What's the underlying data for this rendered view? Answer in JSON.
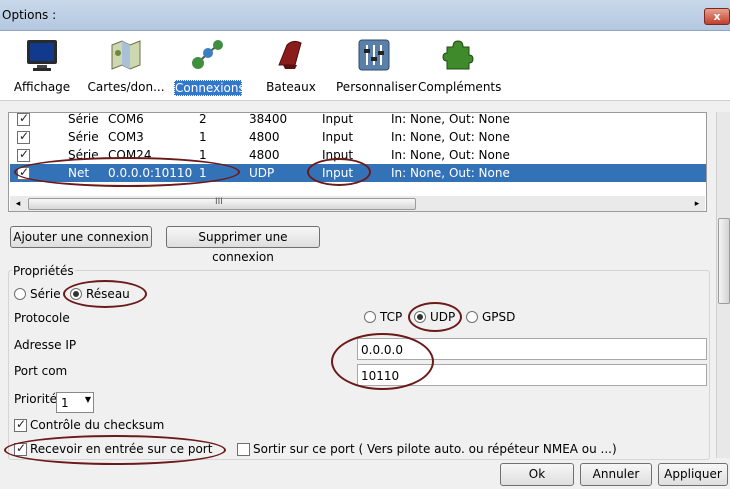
{
  "window": {
    "title": "Options :",
    "close_label": "x"
  },
  "toolbar": [
    {
      "label": "Affichage",
      "icon": "monitor-icon"
    },
    {
      "label": "Cartes/don...",
      "icon": "charts-icon"
    },
    {
      "label": "Connexions",
      "icon": "connections-icon",
      "active": true
    },
    {
      "label": "Bateaux",
      "icon": "boat-icon"
    },
    {
      "label": "Personnaliser",
      "icon": "sliders-icon"
    },
    {
      "label": "Compléments",
      "icon": "puzzle-icon"
    }
  ],
  "connections": {
    "rows": [
      {
        "enabled": true,
        "type": "Série",
        "port": "COM6",
        "priority": "2",
        "speed": "38400",
        "direction": "Input",
        "filter": "In: None, Out: None"
      },
      {
        "enabled": true,
        "type": "Série",
        "port": "COM3",
        "priority": "1",
        "speed": "4800",
        "direction": "Input",
        "filter": "In: None, Out: None"
      },
      {
        "enabled": true,
        "type": "Série",
        "port": "COM24",
        "priority": "1",
        "speed": "4800",
        "direction": "Input",
        "filter": "In: None, Out: None"
      },
      {
        "enabled": true,
        "type": "Net",
        "port": "0.0.0.0:10110",
        "priority": "1",
        "speed": "UDP",
        "direction": "Input",
        "filter": "In: None, Out: None",
        "selected": true
      }
    ],
    "scroll_grip": "III",
    "add_label": "Ajouter une connexion",
    "remove_label": "Supprimer une connexion"
  },
  "properties": {
    "title": "Propriétés",
    "serie_label": "Série",
    "reseau_label": "Réseau",
    "protocole_label": "Protocole",
    "tcp_label": "TCP",
    "udp_label": "UDP",
    "gpsd_label": "GPSD",
    "ip_label": "Adresse IP",
    "ip_value": "0.0.0.0",
    "port_label": "Port com",
    "port_value": "10110",
    "priority_label": "Priorité",
    "priority_value": "1",
    "checksum_label": "Contrôle du checksum",
    "receive_label": "Recevoir en entrée sur ce port",
    "send_label": "Sortir sur ce port ( Vers pilote auto. ou répéteur NMEA ou ...)"
  },
  "footer": {
    "ok_label": "Ok",
    "cancel_label": "Annuler",
    "apply_label": "Appliquer"
  }
}
